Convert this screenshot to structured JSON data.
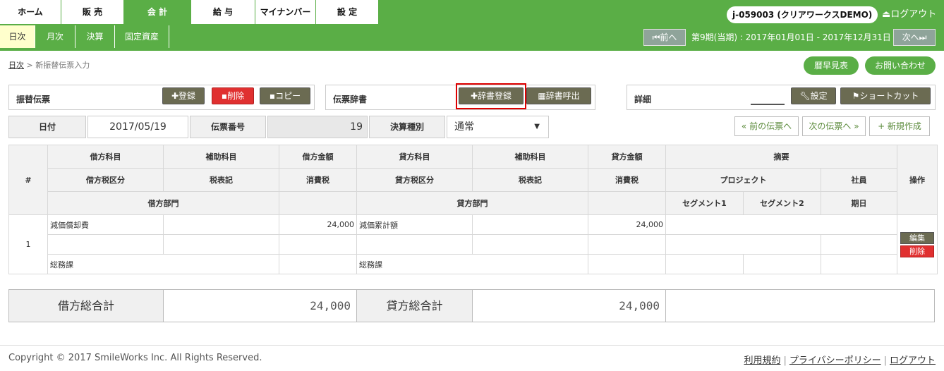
{
  "nav": {
    "tabs": [
      "ホーム",
      "販 売",
      "会 計",
      "給 与",
      "マイナンバー",
      "設 定"
    ],
    "active_tab": 2,
    "user": "j-059003 (クリアワークスDEMO)",
    "logout": "ログアウト",
    "subtabs": [
      "日次",
      "月次",
      "決算",
      "固定資産"
    ],
    "active_subtab": 0,
    "prev_label": "前へ",
    "next_label": "次へ",
    "period_text": "第9期(当期) : 2017年01月01日 - 2017年12月31日"
  },
  "breadcrumb": {
    "root": "日次",
    "sep": ">",
    "current": "新振替伝票入力"
  },
  "header_buttons": {
    "calendar": "暦早見表",
    "contact": "お問い合わせ"
  },
  "voucher_panel": {
    "title": "振替伝票",
    "register": "登録",
    "delete": "削除",
    "copy": "コピー"
  },
  "dict_panel": {
    "title": "伝票辞書",
    "register": "辞書登録",
    "call": "辞書呼出"
  },
  "detail_panel": {
    "title": "詳細",
    "settings": "設定",
    "shortcut": "ショートカット"
  },
  "form": {
    "date_label": "日付",
    "date_value": "2017/05/19",
    "number_label": "伝票番号",
    "number_value": "19",
    "type_label": "決算種別",
    "type_value": "通常"
  },
  "voucher_nav": {
    "prev": "« 前の伝票へ",
    "next": "次の伝票へ »",
    "new": "+ 新規作成"
  },
  "table": {
    "headers": {
      "no": "#",
      "debit_account": "借方科目",
      "debit_sub": "補助科目",
      "debit_amount": "借方金額",
      "credit_account": "貸方科目",
      "credit_sub": "補助科目",
      "credit_amount": "貸方金額",
      "summary": "摘要",
      "operation": "操作",
      "debit_tax_class": "借方税区分",
      "debit_tax_mark": "税表記",
      "debit_tax": "消費税",
      "credit_tax_class": "貸方税区分",
      "credit_tax_mark": "税表記",
      "credit_tax": "消費税",
      "project": "プロジェクト",
      "employee": "社員",
      "debit_dept": "借方部門",
      "credit_dept": "貸方部門",
      "segment1": "セグメント1",
      "segment2": "セグメント2",
      "due_date": "期日"
    },
    "rows": [
      {
        "no": "1",
        "debit_account": "減価償却費",
        "debit_amount": "24,000",
        "credit_account": "減価累計額",
        "credit_amount": "24,000",
        "debit_dept": "総務課",
        "credit_dept": "総務課",
        "edit": "編集",
        "delete": "削除"
      }
    ]
  },
  "totals": {
    "debit_label": "借方総合計",
    "debit_value": "24,000",
    "credit_label": "貸方総合計",
    "credit_value": "24,000"
  },
  "footer": {
    "copyright": "Copyright © 2017 SmileWorks Inc. All Rights Reserved.",
    "links": [
      "利用規約",
      "プライバシーポリシー",
      "ログアウト"
    ]
  },
  "colors": {
    "brand_green": "#5aae46",
    "highlight": "#dd0000"
  }
}
